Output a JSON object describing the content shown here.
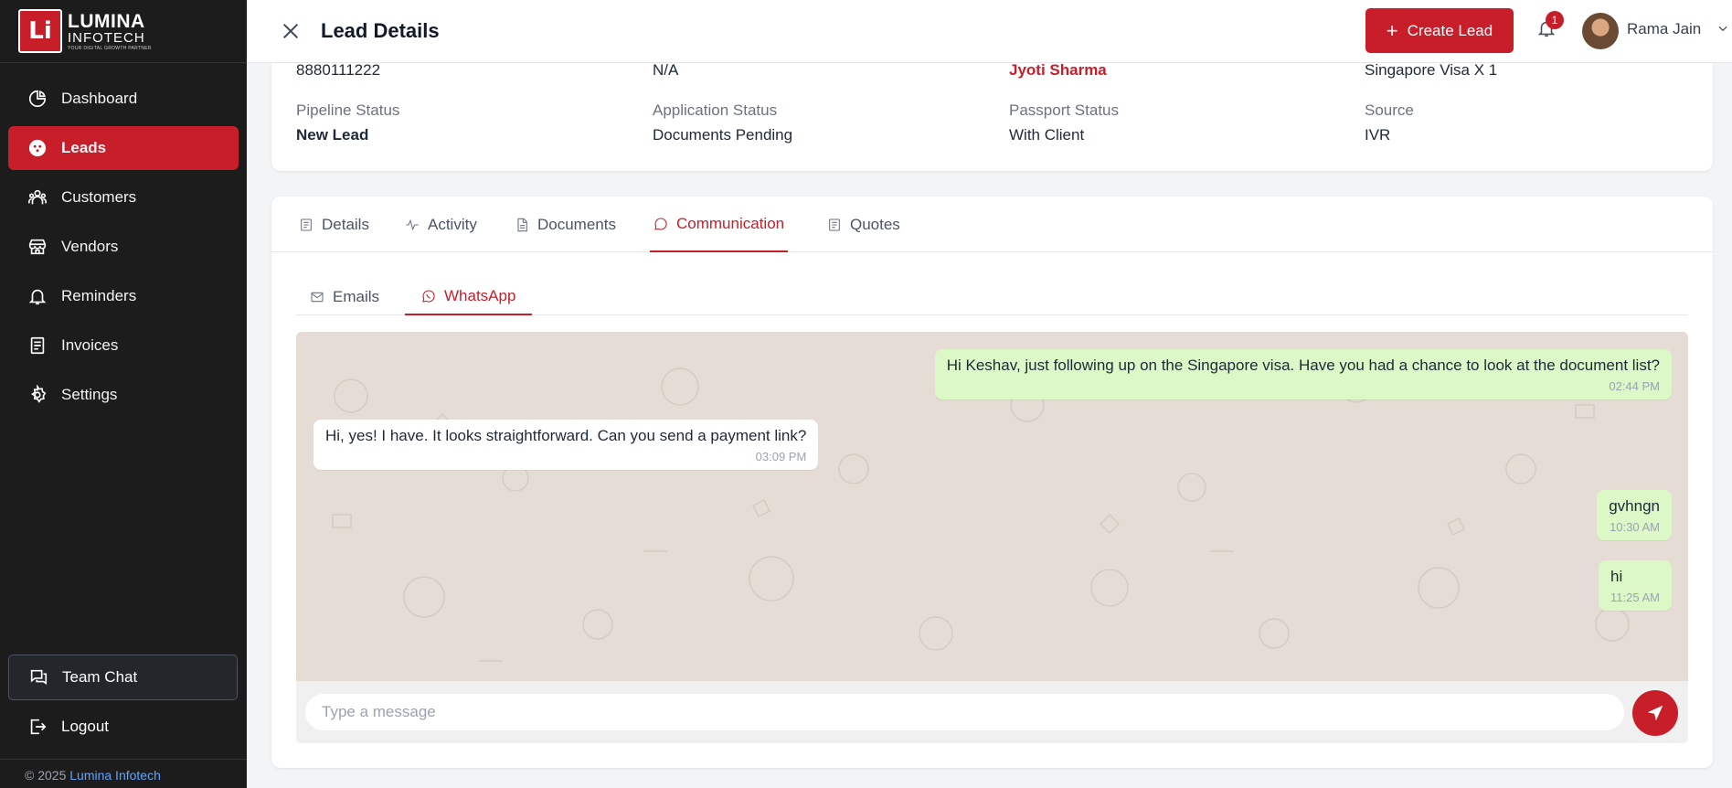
{
  "brand": {
    "logo_letters": "Li",
    "name": "LUMINA",
    "sub": "INFOTECH",
    "tagline": "YOUR DIGITAL GROWTH PARTNER"
  },
  "sidebar": {
    "items": [
      {
        "label": "Dashboard",
        "icon": "pie-chart-icon"
      },
      {
        "label": "Leads",
        "icon": "target-icon",
        "active": true
      },
      {
        "label": "Customers",
        "icon": "users-icon"
      },
      {
        "label": "Vendors",
        "icon": "store-icon"
      },
      {
        "label": "Reminders",
        "icon": "bell-icon"
      },
      {
        "label": "Invoices",
        "icon": "invoice-icon"
      },
      {
        "label": "Settings",
        "icon": "gear-icon"
      }
    ],
    "team_chat": "Team Chat",
    "logout": "Logout",
    "copyright_prefix": "© 2025",
    "copyright_company": "Lumina Infotech"
  },
  "header": {
    "title": "Lead Details",
    "create_label": "Create Lead",
    "notification_count": "1",
    "user_name": "Rama Jain"
  },
  "lead": {
    "phone": "8880111222",
    "secondary": "N/A",
    "assignee": "Jyoti Sharma",
    "package": "Singapore Visa X 1",
    "pipeline_label": "Pipeline Status",
    "pipeline_value": "New Lead",
    "application_label": "Application Status",
    "application_value": "Documents Pending",
    "passport_label": "Passport Status",
    "passport_value": "With Client",
    "source_label": "Source",
    "source_value": "IVR"
  },
  "tabs": [
    {
      "label": "Details",
      "icon": "details-icon"
    },
    {
      "label": "Activity",
      "icon": "activity-icon"
    },
    {
      "label": "Documents",
      "icon": "document-icon"
    },
    {
      "label": "Communication",
      "icon": "chat-bubble-icon",
      "active": true
    },
    {
      "label": "Quotes",
      "icon": "quote-icon"
    }
  ],
  "subtabs": [
    {
      "label": "Emails",
      "icon": "mail-icon"
    },
    {
      "label": "WhatsApp",
      "icon": "whatsapp-icon",
      "active": true
    }
  ],
  "messages": [
    {
      "direction": "out",
      "text": "Hi Keshav, just following up on the Singapore visa. Have you had a chance to look at the document list?",
      "time": "02:44 PM"
    },
    {
      "direction": "in",
      "text": "Hi, yes! I have. It looks straightforward. Can you send a payment link?",
      "time": "03:09 PM"
    },
    {
      "direction": "out",
      "text": "gvhngn",
      "time": "10:30 AM"
    },
    {
      "direction": "out",
      "text": "hi",
      "time": "11:25 AM"
    }
  ],
  "composer": {
    "placeholder": "Type a message",
    "value": ""
  },
  "colors": {
    "accent": "#c81e2a",
    "sidebar_bg": "#1c1c1c",
    "chat_bg": "#e5ddd5",
    "outgoing_bubble": "#dcf8c6"
  }
}
